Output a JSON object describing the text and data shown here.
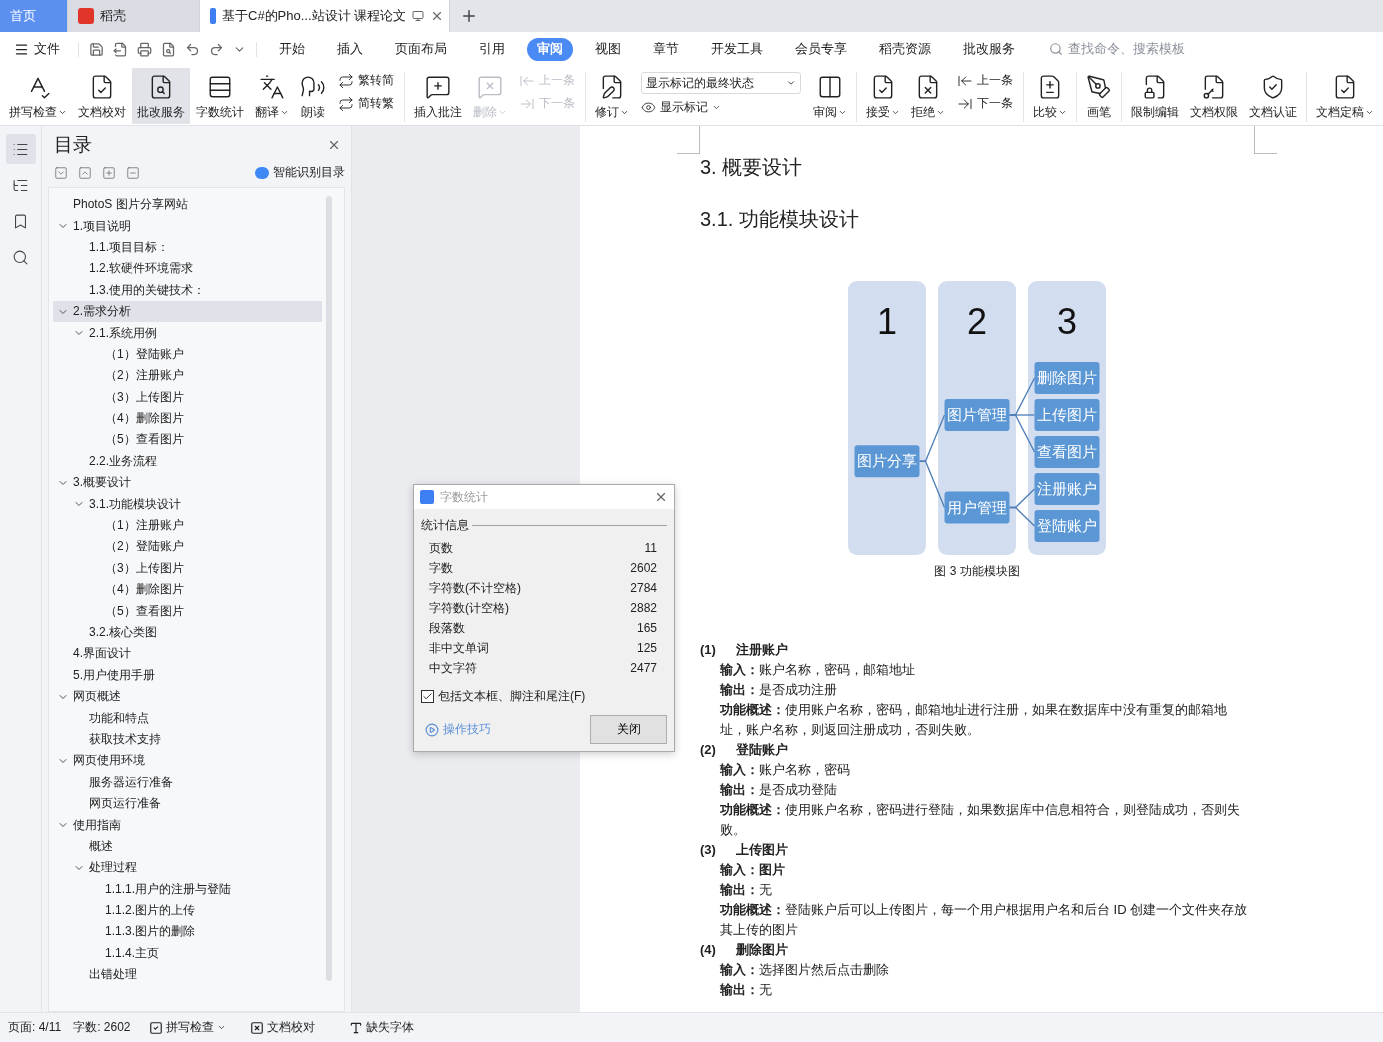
{
  "tabs": [
    {
      "label": "首页",
      "kind": "home",
      "selected": false
    },
    {
      "label": "稻壳",
      "kind": "app",
      "selected": false
    },
    {
      "label": "基于C#的Pho...站设计 课程论文",
      "kind": "doc",
      "selected": true
    }
  ],
  "menu": {
    "file_label": "文件",
    "tabs": [
      {
        "label": "开始",
        "selected": false
      },
      {
        "label": "插入",
        "selected": false
      },
      {
        "label": "页面布局",
        "selected": false
      },
      {
        "label": "引用",
        "selected": false
      },
      {
        "label": "审阅",
        "selected": true
      },
      {
        "label": "视图",
        "selected": false
      },
      {
        "label": "章节",
        "selected": false
      },
      {
        "label": "开发工具",
        "selected": false
      },
      {
        "label": "会员专享",
        "selected": false
      },
      {
        "label": "稻壳资源",
        "selected": false
      },
      {
        "label": "批改服务",
        "selected": false
      }
    ],
    "search_placeholder": "查找命令、搜索模板"
  },
  "ribbon": [
    {
      "kind": "big",
      "label": "拼写检查",
      "dropdown": true,
      "disabled": false,
      "selected": false
    },
    {
      "kind": "big",
      "label": "文档校对",
      "dropdown": false,
      "disabled": false,
      "selected": false
    },
    {
      "kind": "big",
      "label": "批改服务",
      "dropdown": false,
      "disabled": false,
      "selected": true
    },
    {
      "kind": "big",
      "label": "字数统计",
      "dropdown": false,
      "disabled": false,
      "selected": false
    },
    {
      "kind": "big",
      "label": "翻译",
      "dropdown": true,
      "disabled": false,
      "selected": false
    },
    {
      "kind": "big",
      "label": "朗读",
      "dropdown": false,
      "disabled": false,
      "selected": false
    },
    {
      "kind": "pair",
      "rows": [
        {
          "label": "繁转简",
          "disabled": false
        },
        {
          "label": "简转繁",
          "disabled": false
        }
      ]
    },
    {
      "kind": "divider"
    },
    {
      "kind": "big",
      "label": "插入批注",
      "dropdown": false,
      "disabled": false,
      "selected": false
    },
    {
      "kind": "big",
      "label": "删除",
      "dropdown": true,
      "disabled": true,
      "selected": false
    },
    {
      "kind": "pair",
      "rows": [
        {
          "label": "上一条",
          "disabled": true
        },
        {
          "label": "下一条",
          "disabled": true
        }
      ]
    },
    {
      "kind": "divider"
    },
    {
      "kind": "big",
      "label": "修订",
      "dropdown": true,
      "disabled": false,
      "selected": false
    },
    {
      "kind": "select",
      "value": "显示标记的最终状态",
      "label": "显示标记"
    },
    {
      "kind": "big",
      "label": "审阅",
      "dropdown": true,
      "disabled": false,
      "selected": false
    },
    {
      "kind": "divider"
    },
    {
      "kind": "big",
      "label": "接受",
      "dropdown": true,
      "disabled": false,
      "selected": false
    },
    {
      "kind": "big",
      "label": "拒绝",
      "dropdown": true,
      "disabled": false,
      "selected": false
    },
    {
      "kind": "pair",
      "rows": [
        {
          "label": "上一条",
          "disabled": false
        },
        {
          "label": "下一条",
          "disabled": false
        }
      ]
    },
    {
      "kind": "divider"
    },
    {
      "kind": "big",
      "label": "比较",
      "dropdown": true,
      "disabled": false,
      "selected": false
    },
    {
      "kind": "divider"
    },
    {
      "kind": "big",
      "label": "画笔",
      "dropdown": false,
      "disabled": false,
      "selected": false
    },
    {
      "kind": "divider"
    },
    {
      "kind": "big",
      "label": "限制编辑",
      "dropdown": false,
      "disabled": false,
      "selected": false
    },
    {
      "kind": "big",
      "label": "文档权限",
      "dropdown": false,
      "disabled": false,
      "selected": false
    },
    {
      "kind": "big",
      "label": "文档认证",
      "dropdown": false,
      "disabled": false,
      "selected": false
    },
    {
      "kind": "divider"
    },
    {
      "kind": "big",
      "label": "文档定稿",
      "dropdown": true,
      "disabled": false,
      "selected": false
    }
  ],
  "rail": [
    {
      "selected": true
    },
    {
      "selected": false
    },
    {
      "selected": false
    },
    {
      "selected": false
    }
  ],
  "outline": {
    "title": "目录",
    "smart_toc": "智能识别目录",
    "tree": [
      {
        "label": "PhotoS 图片分享网站",
        "selected": false
      },
      {
        "label": "1.项目说明",
        "selected": false,
        "expanded": true,
        "children": [
          {
            "label": "1.1.项目目标：",
            "selected": false
          },
          {
            "label": "1.2.软硬件环境需求",
            "selected": false
          },
          {
            "label": "1.3.使用的关键技术：",
            "selected": false
          }
        ]
      },
      {
        "label": "2.需求分析",
        "selected": true,
        "expanded": true,
        "children": [
          {
            "label": "2.1.系统用例",
            "selected": false,
            "expanded": true,
            "children": [
              {
                "label": "（1）登陆账户",
                "selected": false
              },
              {
                "label": "（2）注册账户",
                "selected": false
              },
              {
                "label": "（3）上传图片",
                "selected": false
              },
              {
                "label": "（4）删除图片",
                "selected": false
              },
              {
                "label": "（5）查看图片",
                "selected": false
              }
            ]
          },
          {
            "label": "2.2.业务流程",
            "selected": false
          }
        ]
      },
      {
        "label": "3.概要设计",
        "selected": false,
        "expanded": true,
        "children": [
          {
            "label": "3.1.功能模块设计",
            "selected": false,
            "expanded": true,
            "children": [
              {
                "label": "（1）注册账户",
                "selected": false
              },
              {
                "label": "（2）登陆账户",
                "selected": false
              },
              {
                "label": "（3）上传图片",
                "selected": false
              },
              {
                "label": "（4）删除图片",
                "selected": false
              },
              {
                "label": "（5）查看图片",
                "selected": false
              }
            ]
          },
          {
            "label": "3.2.核心类图",
            "selected": false
          }
        ]
      },
      {
        "label": "4.界面设计",
        "selected": false
      },
      {
        "label": "5.用户使用手册",
        "selected": false
      },
      {
        "label": "网页概述",
        "selected": false,
        "expanded": true,
        "children": [
          {
            "label": "功能和特点",
            "selected": false
          },
          {
            "label": "获取技术支持",
            "selected": false
          }
        ]
      },
      {
        "label": "网页使用环境",
        "selected": false,
        "expanded": true,
        "children": [
          {
            "label": "服务器运行准备",
            "selected": false
          },
          {
            "label": "网页运行准备",
            "selected": false
          }
        ]
      },
      {
        "label": "使用指南",
        "selected": false,
        "expanded": true,
        "children": [
          {
            "label": "概述",
            "selected": false
          },
          {
            "label": "处理过程",
            "selected": false,
            "expanded": true,
            "children": [
              {
                "label": "1.1.1.用户的注册与登陆",
                "selected": false
              },
              {
                "label": "1.1.2.图片的上传",
                "selected": false
              },
              {
                "label": "1.1.3.图片的删除",
                "selected": false
              },
              {
                "label": "1.1.4.主页",
                "selected": false
              }
            ]
          },
          {
            "label": "出错处理",
            "selected": false
          }
        ]
      }
    ]
  },
  "document": {
    "heading": "3.  概要设计",
    "subheading": "3.1.  功能模块设计",
    "diagram": {
      "columns": [
        "1",
        "2",
        "3"
      ],
      "root": {
        "label": "图片分享",
        "children": [
          {
            "label": "图片管理",
            "children": [
              {
                "label": "删除图片"
              },
              {
                "label": "上传图片"
              },
              {
                "label": "查看图片"
              }
            ]
          },
          {
            "label": "用户管理",
            "children": [
              {
                "label": "注册账户"
              },
              {
                "label": "登陆账户"
              }
            ]
          }
        ]
      }
    },
    "caption": "图 3 功能模块图",
    "sections": [
      {
        "number": "(1)",
        "title": "注册账户",
        "lines": [
          "**输入：**账户名称，密码，邮箱地址",
          "**输出：**是否成功注册",
          "**功能概述：**使用账户名称，密码，邮箱地址进行注册，如果在数据库中没有重复的邮箱地址，账户名称，则返回注册成功，否则失败。"
        ]
      },
      {
        "number": "(2)",
        "title": "登陆账户",
        "lines": [
          "**输入：**账户名称，密码",
          "**输出：**是否成功登陆",
          "**功能概述：**使用账户名称，密码进行登陆，如果数据库中信息相符合，则登陆成功，否则失败。"
        ]
      },
      {
        "number": "(3)",
        "title": "上传图片",
        "lines": [
          "**输入：图片**",
          "**输出：**无",
          "**功能概述：**登陆账户后可以上传图片，每一个用户根据用户名和后台 ID 创建一个文件夹存放其上传的图片"
        ]
      },
      {
        "number": "(4)",
        "title": "删除图片",
        "lines": [
          "**输入：**选择图片然后点击删除",
          "**输出：**无"
        ]
      }
    ]
  },
  "dialog": {
    "title": "字数统计",
    "group": "统计信息",
    "rows": [
      {
        "label": "页数",
        "value": "11"
      },
      {
        "label": "字数",
        "value": "2602"
      },
      {
        "label": "字符数(不计空格)",
        "value": "2784"
      },
      {
        "label": "字符数(计空格)",
        "value": "2882"
      },
      {
        "label": "段落数",
        "value": "165"
      },
      {
        "label": "非中文单词",
        "value": "125"
      },
      {
        "label": "中文字符",
        "value": "2477"
      }
    ],
    "checkbox": {
      "label": "包括文本框、脚注和尾注(F)",
      "checked": true
    },
    "tips": "操作技巧",
    "close_button": "关闭"
  },
  "status": {
    "page": "页面: 4/11",
    "words": "字数: 2602",
    "items": [
      {
        "kind": "toggle",
        "label": "拼写检查",
        "checked": true
      },
      {
        "kind": "proof",
        "label": "文档校对"
      },
      {
        "kind": "font",
        "label": "缺失字体"
      }
    ]
  }
}
